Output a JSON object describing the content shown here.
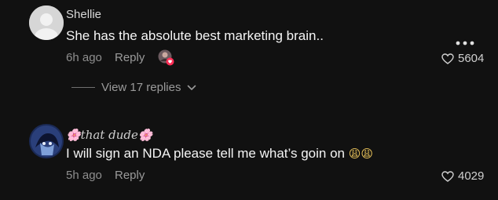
{
  "comments": [
    {
      "username": "Shellie",
      "text": "She has the absolute best marketing brain..",
      "time": "6h ago",
      "reply_label": "Reply",
      "likes": "5604",
      "view_replies_label": "View 17 replies",
      "avatar_color": "#d6d6d6"
    },
    {
      "username": "🌸that dude🌸",
      "text": "I will sign an NDA please tell me what’s goin on",
      "emojis": "😩😩",
      "time": "5h ago",
      "reply_label": "Reply",
      "likes": "4029"
    }
  ],
  "colors": {
    "background": "#111111",
    "secondary_text": "#8e8e8e",
    "creator_heart": "#ff2d55"
  }
}
